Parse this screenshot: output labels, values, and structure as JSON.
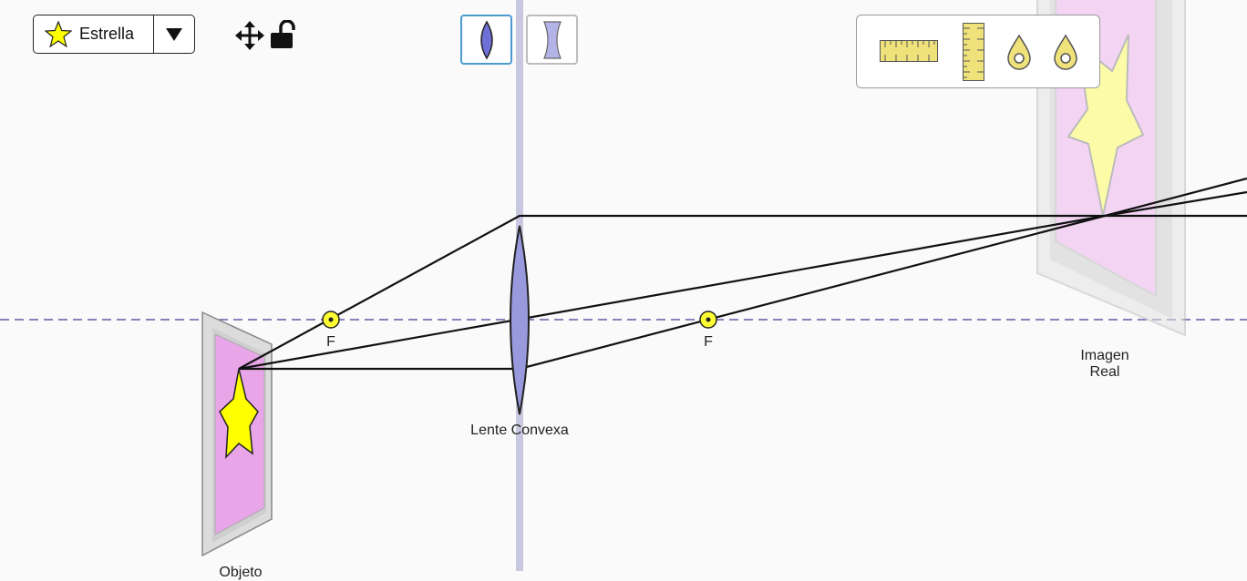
{
  "object_selector": {
    "selected": "Estrella",
    "icon": "star-icon"
  },
  "toolbar": {
    "move_icon": "move-icon",
    "lock_icon": "unlock-icon"
  },
  "lens_types": [
    {
      "name": "convex-lens",
      "icon": "convex-lens-icon",
      "selected": true
    },
    {
      "name": "concave-lens",
      "icon": "concave-lens-icon",
      "selected": false
    }
  ],
  "toolbox": {
    "items": [
      "horizontal-ruler-icon",
      "vertical-ruler-icon",
      "light-probe-icon",
      "light-probe-icon"
    ]
  },
  "scene": {
    "lens_label": "Lente Convexa",
    "focal_label_left": "F",
    "focal_label_right": "F",
    "image_label_line1": "Imagen",
    "image_label_line2": "Real",
    "object_label": "Objeto"
  },
  "colors": {
    "lens_fill": "#9999dd",
    "lens_button_border": "#4a9bd1",
    "axis": "#8c82bb",
    "star_fill": "#ffff00",
    "screen_fill": "#e8a5e8",
    "focal_point": "#ffff33",
    "ruler_fill": "#efe27b"
  }
}
